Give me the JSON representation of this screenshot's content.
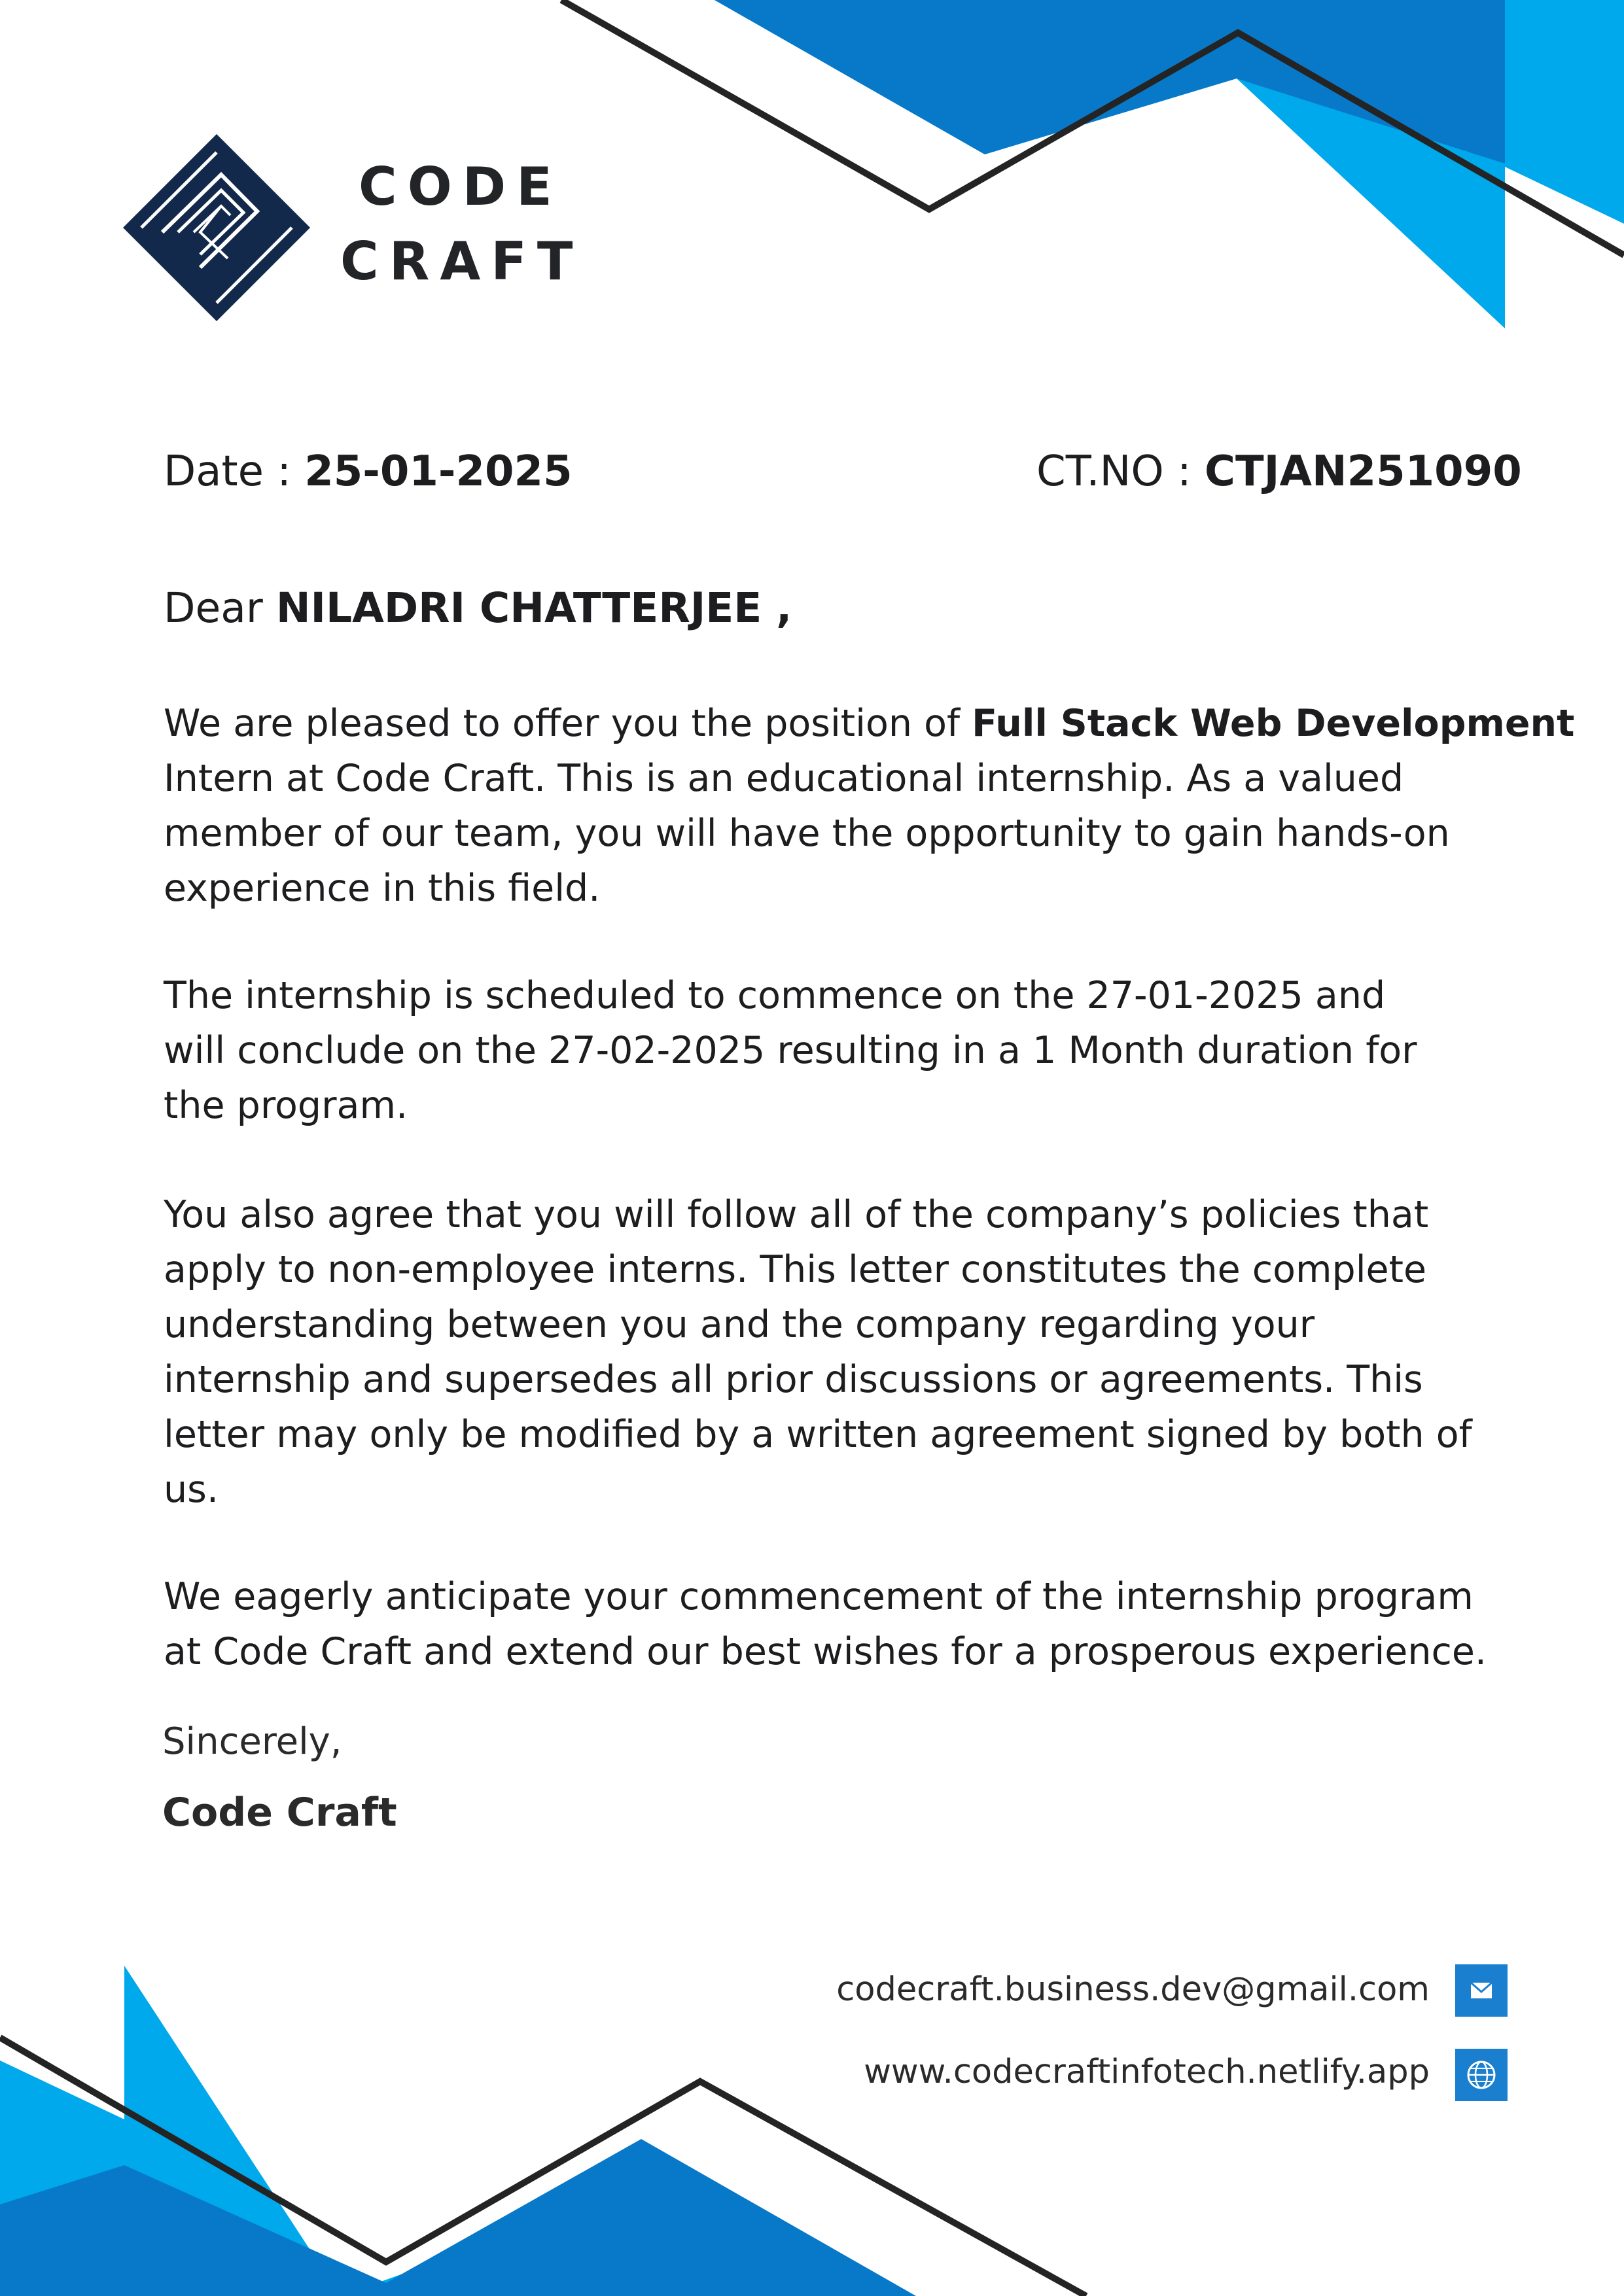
{
  "colors": {
    "accent_dark": "#0878c9",
    "accent_light": "#00a8ec",
    "navy": "#13294b",
    "line": "#242424"
  },
  "brand": {
    "line1": "CODE",
    "line2": "CRAFT"
  },
  "header": {
    "date_label": "Date :",
    "date_value": "25-01-2025",
    "ct_label": "CT.NO :",
    "ct_value": "CTJAN251090"
  },
  "salutation": {
    "prefix": "Dear",
    "name": "NILADRI CHATTERJEE ,"
  },
  "paragraphs": {
    "p1": {
      "line1_prefix": "We are pleased to offer you the position of",
      "position": "Full Stack Web Development",
      "line2": "Intern at Code Craft. This is an educational internship. As a valued",
      "line3": "member of our team, you will have the opportunity to gain hands-on",
      "line4": "experience in this field."
    },
    "p2": {
      "line1": "The internship is scheduled to commence on the 27-01-2025 and",
      "line2": "will conclude on the 27-02-2025 resulting in a 1 Month duration for",
      "line3": "the program."
    },
    "p3": {
      "line1": "You also agree that you will follow all of the company’s policies that",
      "line2": "apply to non-employee interns. This letter constitutes the complete",
      "line3": "understanding between you and the company regarding your",
      "line4": "internship and supersedes all prior discussions or agreements. This",
      "line5": "letter may only be modified by a written agreement signed by both of",
      "line6": "us."
    },
    "p4": {
      "line1": "We eagerly anticipate your commencement of the internship program",
      "line2": "at Code Craft and extend our best wishes for a prosperous experience."
    }
  },
  "closing": {
    "signoff": "Sincerely,",
    "signer": "Code Craft"
  },
  "contact": {
    "email": "codecraft.business.dev@gmail.com",
    "email_icon": "mail-icon",
    "website": "www.codecraftinfotech.netlify.app",
    "website_icon": "globe-icon"
  }
}
